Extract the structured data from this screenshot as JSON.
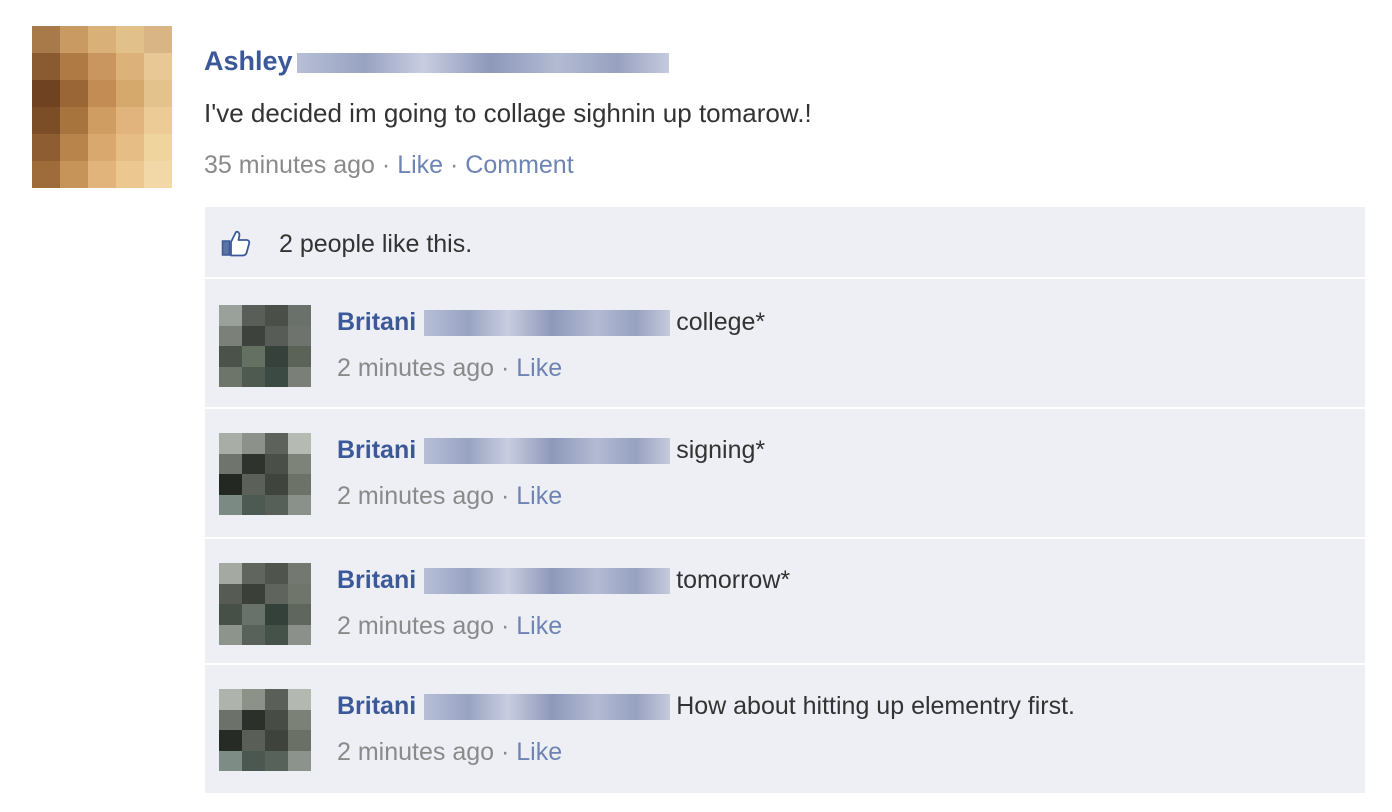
{
  "post": {
    "author": "Ashley",
    "status_text": "I've decided im going to collage sighnin up tomarow.!",
    "time": "35 minutes ago",
    "separator": "·",
    "like_label": "Like",
    "comment_label": "Comment",
    "avatar_colors": [
      "#a87a4a",
      "#c99a62",
      "#d8b078",
      "#e2c08a",
      "#d9b585",
      "#8a5a30",
      "#b07a45",
      "#c8965e",
      "#dcb27a",
      "#e8c894",
      "#6f4322",
      "#9a6636",
      "#c28c54",
      "#d5a86c",
      "#e4c28c",
      "#7c4e28",
      "#a8743e",
      "#cf9c62",
      "#e0b47c",
      "#eccb96",
      "#8e5e32",
      "#b8844c",
      "#d8a86e",
      "#e6bd85",
      "#f0d49e",
      "#9e6c3a",
      "#c69458",
      "#e0b47a",
      "#ecc890",
      "#f2d8a6"
    ]
  },
  "feedback": {
    "likes_text": "2 people like this.",
    "comments": [
      {
        "author": "Britani",
        "text": "college*",
        "time": "2 minutes ago",
        "like_label": "Like",
        "avatar_colors": [
          "#9aa19a",
          "#595f58",
          "#4a5048",
          "#6a706a",
          "#7b8179",
          "#3d433c",
          "#575d56",
          "#6e746d",
          "#4b5249",
          "#647062",
          "#35413a",
          "#5b6359",
          "#6d756b",
          "#4e5a50",
          "#3c4a44",
          "#7a8078"
        ]
      },
      {
        "author": "Britani",
        "text": "signing*",
        "time": "2 minutes ago",
        "like_label": "Like",
        "avatar_colors": [
          "#a8ada6",
          "#8c9189",
          "#5d635b",
          "#b5bab2",
          "#6f756c",
          "#2e332d",
          "#4a5047",
          "#7d8379",
          "#232822",
          "#5b6158",
          "#3f453d",
          "#6c7268",
          "#7c8a84",
          "#4d5a54",
          "#566059",
          "#8a918b"
        ]
      },
      {
        "author": "Britani",
        "text": "tomorrow*",
        "time": "2 minutes ago",
        "like_label": "Like",
        "avatar_colors": [
          "#a4a9a2",
          "#60665e",
          "#4f554c",
          "#737970",
          "#565c53",
          "#3a4038",
          "#5f655c",
          "#6f756b",
          "#475046",
          "#68716a",
          "#34413a",
          "#5e665d",
          "#8c948c",
          "#58625b",
          "#44524a",
          "#8b918a"
        ]
      },
      {
        "author": "Britani",
        "text": "How about hitting up elementry first.",
        "time": "2 minutes ago",
        "like_label": "Like",
        "avatar_colors": [
          "#aeb3ab",
          "#8d9289",
          "#5a6057",
          "#b3b8b0",
          "#6c7269",
          "#2b302a",
          "#474d44",
          "#7b8177",
          "#262b25",
          "#595f56",
          "#3e443c",
          "#6a7066",
          "#7e8c86",
          "#4b5852",
          "#56625a",
          "#8c938c"
        ]
      }
    ]
  },
  "colors": {
    "link": "#3b5998",
    "accent": "#6d84b4",
    "panel": "#edeff4"
  }
}
